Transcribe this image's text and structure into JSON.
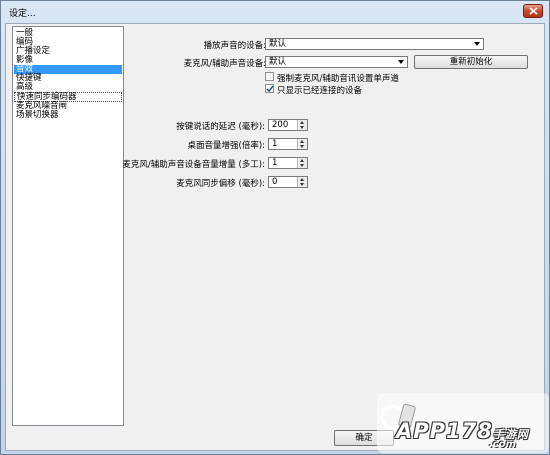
{
  "window": {
    "title": "设定..."
  },
  "sidebar": {
    "items": [
      {
        "label": "一般"
      },
      {
        "label": "编码"
      },
      {
        "label": "广播设定"
      },
      {
        "label": "影像"
      },
      {
        "label": "音效",
        "selected": true
      },
      {
        "label": "快捷键"
      },
      {
        "label": "高级"
      },
      {
        "label": "快速同步编码器"
      },
      {
        "label": "麦克风噪音闸"
      },
      {
        "label": "场景切换器"
      }
    ]
  },
  "audio": {
    "playback_label": "播放声音的设备:",
    "playback_value": "默认",
    "mic_label": "麦克风/辅助声音设备:",
    "mic_value": "默认",
    "reinit_label": "重新初始化",
    "force_mono_label": "强制麦克风/辅助音讯设置单声道",
    "force_mono_checked": false,
    "only_connected_label": "只显示已经连接的设备",
    "only_connected_checked": true,
    "ptt_delay_label": "按键说话的延迟 (毫秒):",
    "ptt_delay_value": "200",
    "desktop_boost_label": "桌面音量增强(倍率):",
    "desktop_boost_value": "1",
    "mic_boost_label": "麦克风/辅助声音设备音量增量 (多工):",
    "mic_boost_value": "1",
    "mic_offset_label": "麦克风同步偏移 (毫秒):",
    "mic_offset_value": "0"
  },
  "footer": {
    "ok_label": "确定"
  },
  "watermark": {
    "text": "APP178",
    "sub": "手游网",
    "domain": ".com"
  }
}
